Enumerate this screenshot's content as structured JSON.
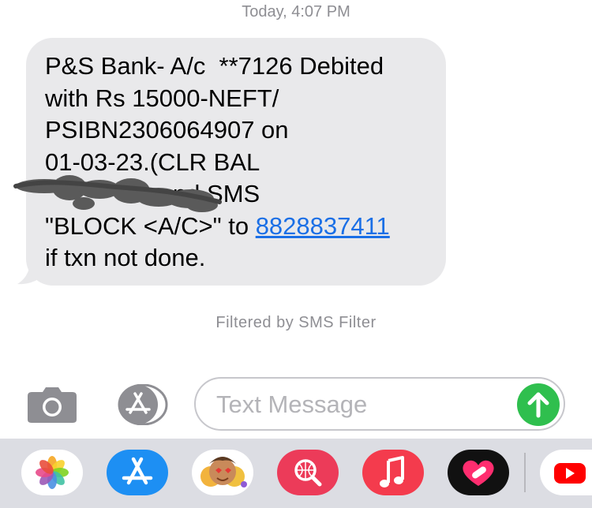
{
  "header": {
    "timestamp": "Today, 4:07 PM"
  },
  "message": {
    "line1": "P&S Bank- A/c  **7126 Debited",
    "line2": "with Rs 15000-NEFT/",
    "line3": "PSIBN2306064907 on",
    "line4": "01-03-23.(CLR BAL",
    "line5_text": "               send SMS",
    "line6_text": "\"BLOCK <A/C>\" to ",
    "phone_link": "8828837411",
    "line7": "if txn not done."
  },
  "filter_note": "Filtered by SMS Filter",
  "compose": {
    "placeholder": "Text Message"
  },
  "dock": {
    "apps": [
      "photos-icon",
      "app-store-icon",
      "memoji-icon",
      "web-search-icon",
      "music-icon",
      "heart-app-icon",
      "youtube-icon"
    ]
  },
  "colors": {
    "bubble": "#e9e9eb",
    "link": "#1a6fe6",
    "send": "#2fbf4e",
    "dock": "#dcdde3"
  }
}
